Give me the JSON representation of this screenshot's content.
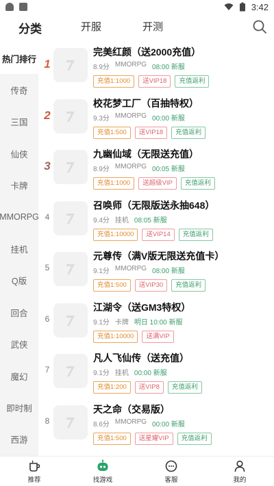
{
  "status_bar": {
    "time": "3:42"
  },
  "top_tabs": [
    {
      "label": "分类",
      "active": true
    },
    {
      "label": "开服",
      "active": false
    },
    {
      "label": "开测",
      "active": false
    }
  ],
  "sidebar": {
    "items": [
      {
        "label": "热门排行",
        "active": true
      },
      {
        "label": "传奇"
      },
      {
        "label": "三国"
      },
      {
        "label": "仙侠"
      },
      {
        "label": "卡牌"
      },
      {
        "label": "MMORPG"
      },
      {
        "label": "挂机"
      },
      {
        "label": "Q版"
      },
      {
        "label": "回合"
      },
      {
        "label": "武侠"
      },
      {
        "label": "魔幻"
      },
      {
        "label": "即时制"
      },
      {
        "label": "西游"
      }
    ]
  },
  "games": [
    {
      "rank": "1",
      "title": "完美红颜（送2000充值）",
      "score": "8.9分",
      "genre": "MMORPG",
      "time": "08:00 新服",
      "tags": [
        {
          "text": "充值1:1000",
          "color": "orange"
        },
        {
          "text": "送VIP18",
          "color": "red"
        },
        {
          "text": "充值返利",
          "color": "green"
        }
      ]
    },
    {
      "rank": "2",
      "title": "校花梦工厂（百抽特权）",
      "score": "9.3分",
      "genre": "MMORPG",
      "time": "00:00 新服",
      "tags": [
        {
          "text": "充值1:500",
          "color": "orange"
        },
        {
          "text": "送VIP18",
          "color": "red"
        },
        {
          "text": "充值返利",
          "color": "green"
        }
      ]
    },
    {
      "rank": "3",
      "title": "九幽仙域（无限送充值）",
      "score": "8.9分",
      "genre": "MMORPG",
      "time": "00:05 新服",
      "tags": [
        {
          "text": "充值1:1000",
          "color": "orange"
        },
        {
          "text": "送超级VIP",
          "color": "red"
        },
        {
          "text": "充值返利",
          "color": "green"
        }
      ]
    },
    {
      "rank": "4",
      "title": "召唤师（无限版送永抽648）",
      "score": "9.4分",
      "genre": "挂机",
      "time": "08:05 新服",
      "tags": [
        {
          "text": "充值1:10000",
          "color": "orange"
        },
        {
          "text": "送VIP14",
          "color": "red"
        },
        {
          "text": "充值返利",
          "color": "green"
        }
      ]
    },
    {
      "rank": "5",
      "title": "元尊传（满V版无限送充值卡）",
      "score": "9.1分",
      "genre": "MMORPG",
      "time": "08:00 新服",
      "tags": [
        {
          "text": "充值1:500",
          "color": "orange"
        },
        {
          "text": "送VIP30",
          "color": "red"
        },
        {
          "text": "充值返利",
          "color": "green"
        }
      ]
    },
    {
      "rank": "6",
      "title": "江湖令（送GM3特权）",
      "score": "9.1分",
      "genre": "卡牌",
      "time": "明日 10:00 新服",
      "tags": [
        {
          "text": "充值1:10000",
          "color": "orange"
        },
        {
          "text": "送满VIP",
          "color": "red"
        }
      ]
    },
    {
      "rank": "7",
      "title": "凡人飞仙传（送充值）",
      "score": "9.1分",
      "genre": "挂机",
      "time": "00:00 新服",
      "tags": [
        {
          "text": "充值1:200",
          "color": "orange"
        },
        {
          "text": "送VIP8",
          "color": "red"
        },
        {
          "text": "充值返利",
          "color": "green"
        }
      ]
    },
    {
      "rank": "8",
      "title": "天之命（交易版）",
      "score": "8.6分",
      "genre": "MMORPG",
      "time": "00:00 新服",
      "tags": [
        {
          "text": "充值1:500",
          "color": "orange"
        },
        {
          "text": "送星耀VIP",
          "color": "red"
        },
        {
          "text": "充值返利",
          "color": "green"
        }
      ]
    }
  ],
  "bottom_nav": [
    {
      "label": "推荐",
      "icon": "cup-icon"
    },
    {
      "label": "找游戏",
      "icon": "gamepad-robot-icon"
    },
    {
      "label": "客服",
      "icon": "chat-icon"
    },
    {
      "label": "我的",
      "icon": "user-icon"
    }
  ],
  "colors": {
    "accent_green": "#3a9d6b",
    "orange": "#e08a2a",
    "red": "#e0626a",
    "rank_top": "#d9603a"
  }
}
